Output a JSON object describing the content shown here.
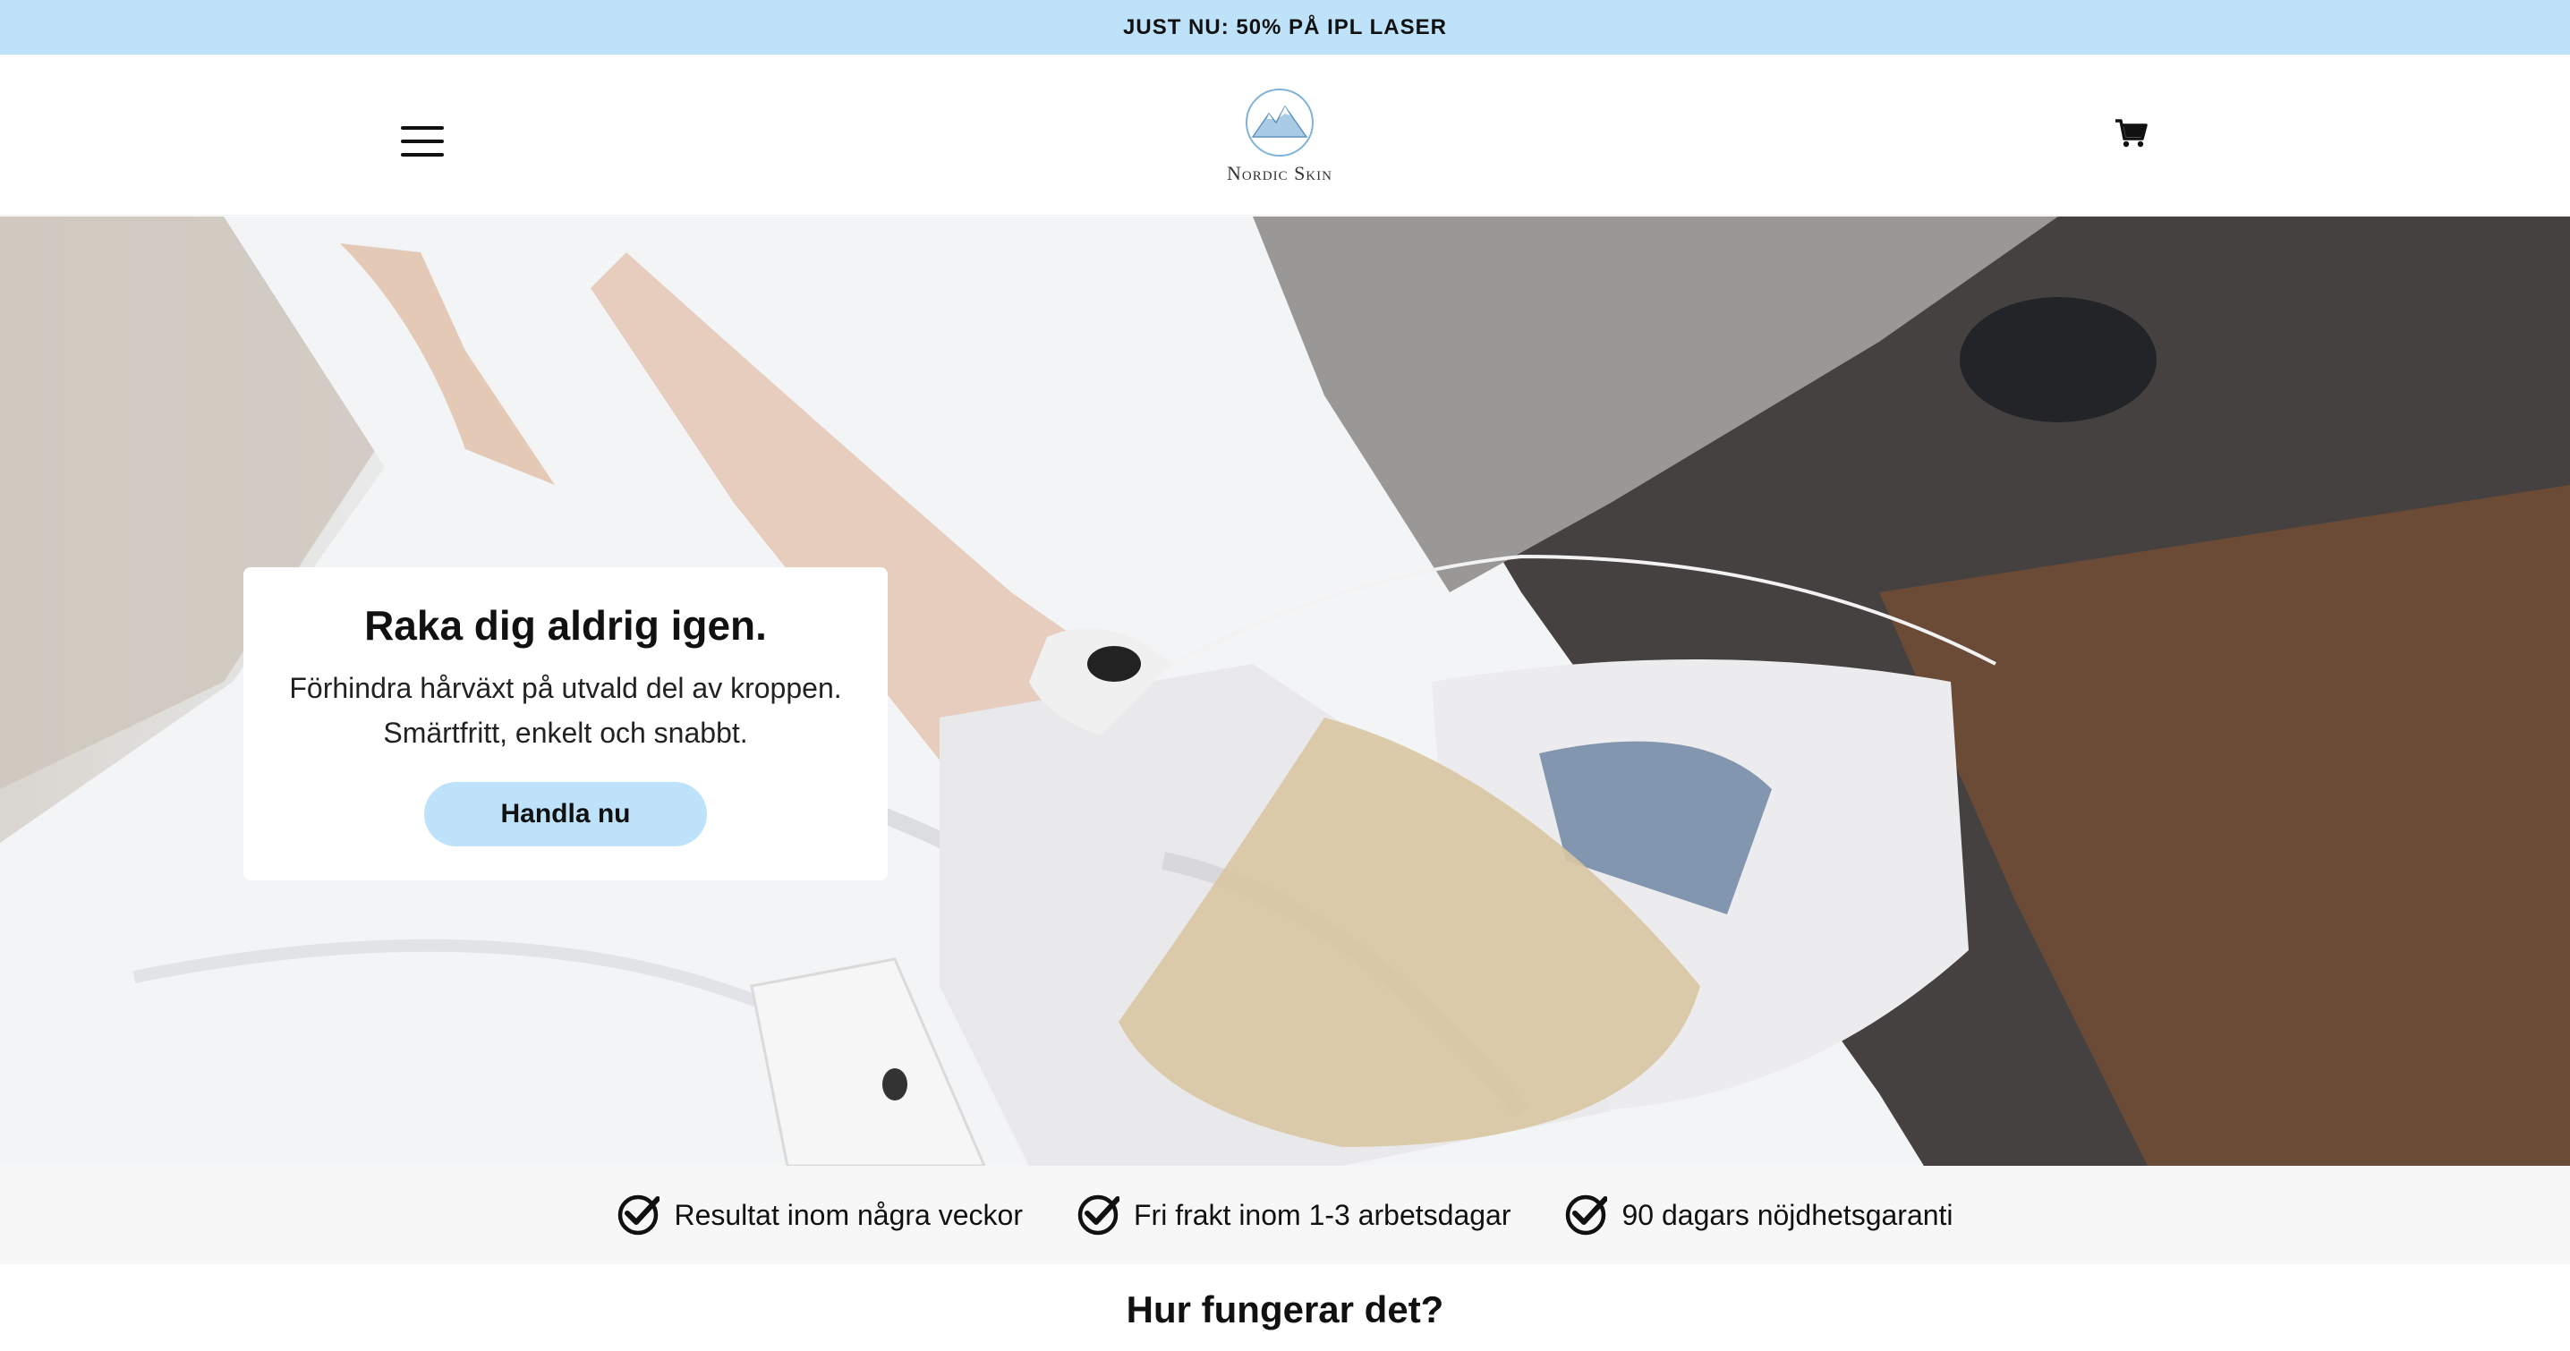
{
  "announcement": {
    "text": "JUST NU: 50% PÅ IPL LASER"
  },
  "header": {
    "menu_icon": "hamburger-menu-icon",
    "logo_text": "Nordic Skin",
    "cart_icon": "cart-icon"
  },
  "hero": {
    "title": "Raka dig aldrig igen.",
    "text": "Förhindra hårväxt på utvald del av kroppen. Smärtfritt, enkelt och snabbt.",
    "button_label": "Handla nu"
  },
  "features": [
    {
      "icon": "check-circle-icon",
      "label": "Resultat inom några veckor"
    },
    {
      "icon": "check-circle-icon",
      "label": "Fri frakt inom 1-3 arbetsdagar"
    },
    {
      "icon": "check-circle-icon",
      "label": "90 dagars nöjdhetsgaranti"
    }
  ],
  "section": {
    "title": "Hur fungerar det?"
  },
  "colors": {
    "accent": "#bde2f9",
    "text": "#111111",
    "feature_bg": "#f7f7f7"
  }
}
